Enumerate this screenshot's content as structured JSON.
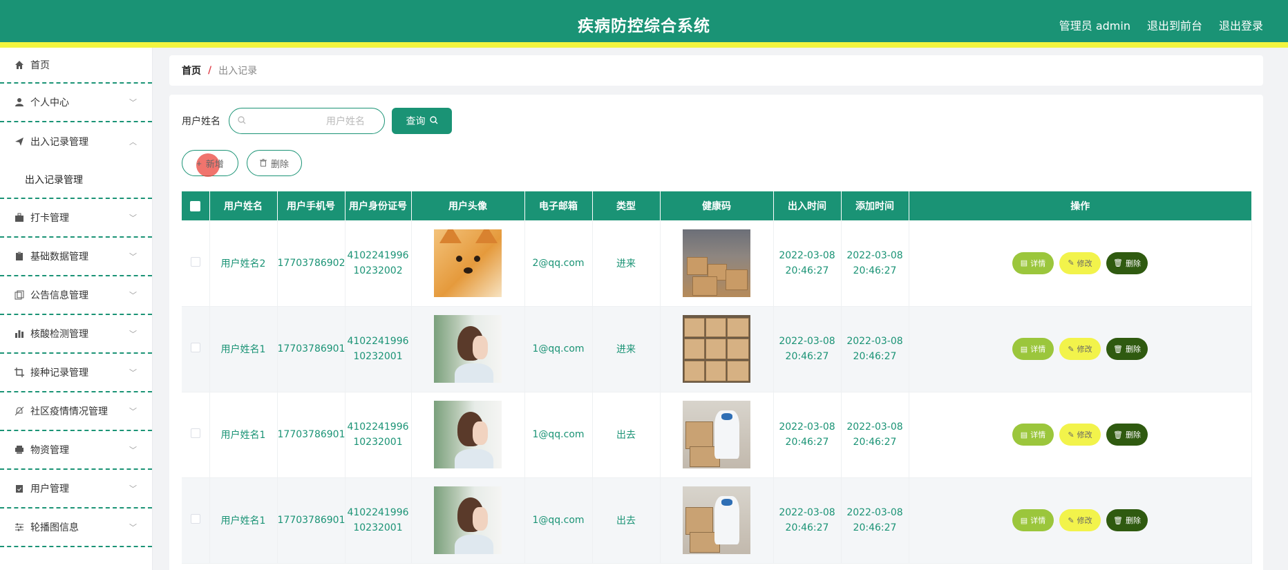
{
  "header": {
    "title": "疾病防控综合系统",
    "admin_label": "管理员 admin",
    "exit_front_label": "退出到前台",
    "logout_label": "退出登录"
  },
  "sidebar": {
    "items": [
      {
        "label": "首页",
        "icon": "home-icon"
      },
      {
        "label": "个人中心",
        "icon": "user-icon"
      },
      {
        "label": "出入记录管理",
        "icon": "send-icon",
        "expanded": true
      },
      {
        "label": "打卡管理",
        "icon": "briefcase-icon"
      },
      {
        "label": "基础数据管理",
        "icon": "clipboard-icon"
      },
      {
        "label": "公告信息管理",
        "icon": "copy-icon"
      },
      {
        "label": "核酸检测管理",
        "icon": "bar-chart-icon"
      },
      {
        "label": "接种记录管理",
        "icon": "crop-icon"
      },
      {
        "label": "社区疫情情况管理",
        "icon": "bell-off-icon"
      },
      {
        "label": "物资管理",
        "icon": "printer-icon"
      },
      {
        "label": "用户管理",
        "icon": "clipboard-check-icon"
      },
      {
        "label": "轮播图信息",
        "icon": "sliders-icon"
      }
    ],
    "submenu": {
      "label": "出入记录管理"
    }
  },
  "breadcrumb": {
    "home": "首页",
    "separator": "/",
    "current": "出入记录"
  },
  "search": {
    "label": "用户姓名",
    "placeholder": "用户姓名",
    "value": "",
    "query_button": "查询"
  },
  "actions": {
    "add_label": "新增",
    "delete_label": "删除"
  },
  "table": {
    "columns": [
      "用户姓名",
      "用户手机号",
      "用户身份证号",
      "用户头像",
      "电子邮箱",
      "类型",
      "健康码",
      "出入时间",
      "添加时间",
      "操作"
    ],
    "rows": [
      {
        "name": "用户姓名2",
        "phone": "17703786902",
        "id_card": "410224199610232002",
        "avatar": "shiba-dog-photo",
        "email": "2@qq.com",
        "type": "进来",
        "health_code": "warehouse-boxes-photo",
        "in_out_time": "2022-03-08 20:46:27",
        "add_time": "2022-03-08 20:46:27"
      },
      {
        "name": "用户姓名1",
        "phone": "17703786901",
        "id_card": "410224199610232001",
        "avatar": "girl-profile-photo",
        "email": "1@qq.com",
        "type": "进来",
        "health_code": "stacked-boxes-photo",
        "in_out_time": "2022-03-08 20:46:27",
        "add_time": "2022-03-08 20:46:27"
      },
      {
        "name": "用户姓名1",
        "phone": "17703786901",
        "id_card": "410224199610232001",
        "avatar": "girl-profile-photo",
        "email": "1@qq.com",
        "type": "出去",
        "health_code": "worker-protective-suit-photo",
        "in_out_time": "2022-03-08 20:46:27",
        "add_time": "2022-03-08 20:46:27"
      },
      {
        "name": "用户姓名1",
        "phone": "17703786901",
        "id_card": "410224199610232001",
        "avatar": "girl-profile-photo",
        "email": "1@qq.com",
        "type": "出去",
        "health_code": "worker-protective-suit-photo",
        "in_out_time": "2022-03-08 20:46:27",
        "add_time": "2022-03-08 20:46:27"
      }
    ],
    "row_actions": {
      "detail": "详情",
      "edit": "修改",
      "delete": "删除"
    }
  },
  "colors": {
    "primary": "#1a9375",
    "accent_strip": "#f2f53f",
    "detail_btn": "#9bc63c",
    "edit_btn": "#f2f34b",
    "delete_btn": "#2f5a10"
  }
}
